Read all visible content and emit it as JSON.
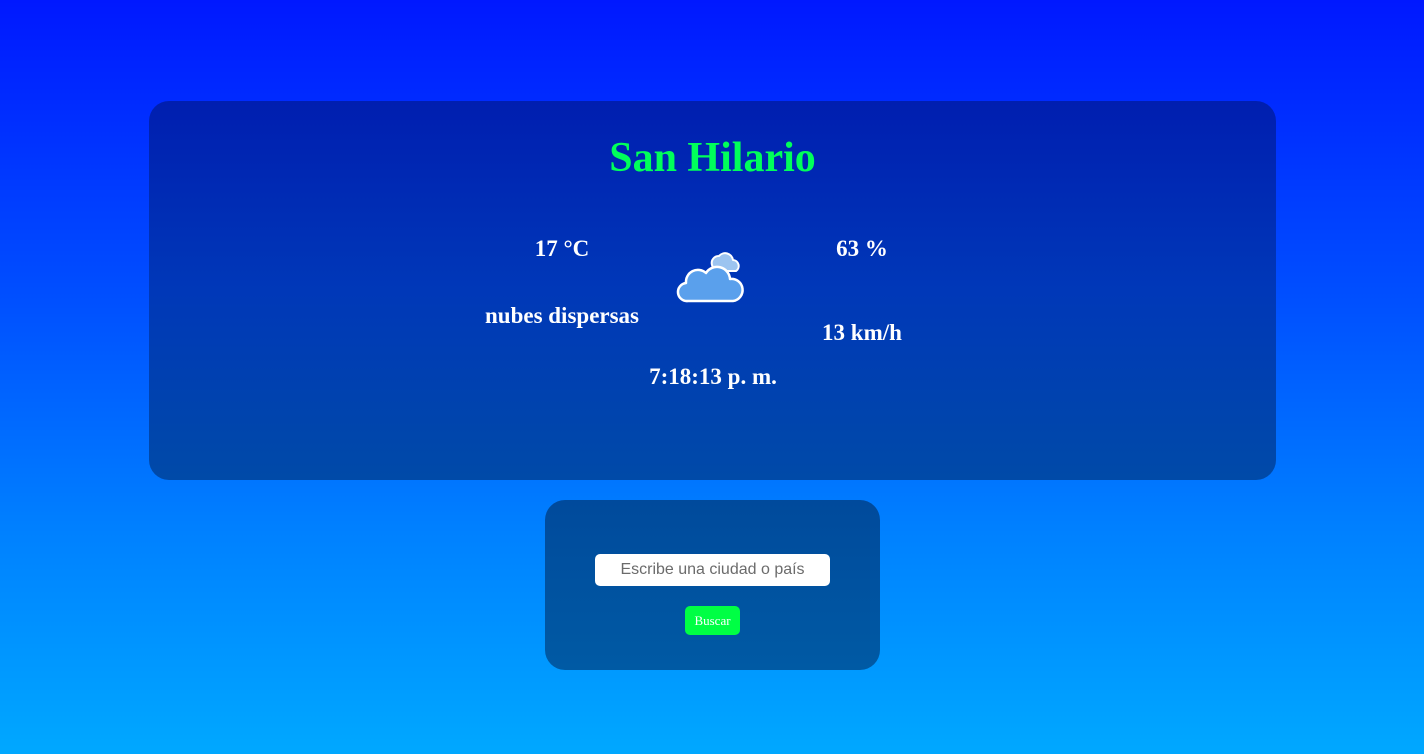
{
  "weather": {
    "city": "San Hilario",
    "temperature": "17 °C",
    "description": "nubes dispersas",
    "humidity": "63 %",
    "wind": "13 km/h",
    "time": "7:18:13 p. m.",
    "icon": "scattered-clouds-icon"
  },
  "search": {
    "placeholder": "Escribe una ciudad o país",
    "value": "",
    "button_label": "Buscar"
  },
  "colors": {
    "title": "#00ff5a",
    "button": "#00ff44",
    "text": "#ffffff"
  }
}
